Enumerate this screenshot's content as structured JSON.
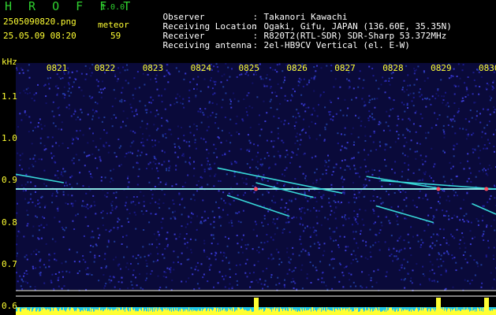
{
  "header": {
    "brand": "H R O F F T",
    "version": "1.0.0",
    "filename": "2505090820.png",
    "datetime": "25.05.09 08:20",
    "meteor_label": "meteor",
    "meteor_count": "59"
  },
  "info": [
    {
      "key": "Observer",
      "sep": ":",
      "value": "Takanori Kawachi"
    },
    {
      "key": "Receiving Location",
      "sep": ":",
      "value": "Ogaki, Gifu, JAPAN (136.60E, 35.35N)"
    },
    {
      "key": "Receiver",
      "sep": ":",
      "value": "R820T2(RTL-SDR) SDR-Sharp 53.372MHz"
    },
    {
      "key": "Receiving antenna",
      "sep": ":",
      "value": "2el-HB9CV Vertical (el. E-W)"
    }
  ],
  "colors": {
    "title_green": "#2fd02f",
    "label_yellow": "#ffff33",
    "info_white": "#ffffff",
    "noise_blue": "#1a1a8c",
    "background": "#000000"
  },
  "chart_data": {
    "type": "heatmap",
    "ylabel": "kHz",
    "x_ticks": [
      "0821",
      "0822",
      "0823",
      "0824",
      "0825",
      "0826",
      "0827",
      "0828",
      "0829",
      "0830"
    ],
    "y_ticks": [
      "1.1",
      "1.0",
      "0.9",
      "0.8",
      "0.7",
      "0.6"
    ],
    "x_range": [
      "0820",
      "0830"
    ],
    "y_range": [
      0.58,
      1.18
    ],
    "carrier_khz": 0.88,
    "meteor_traces": [
      {
        "start_min": 0.0,
        "end_min": 1.0,
        "start_khz": 0.915,
        "end_khz": 0.895
      },
      {
        "start_min": 4.2,
        "end_min": 6.8,
        "start_khz": 0.93,
        "end_khz": 0.87
      },
      {
        "start_min": 4.4,
        "end_min": 5.7,
        "start_khz": 0.865,
        "end_khz": 0.815
      },
      {
        "start_min": 5.0,
        "end_min": 6.2,
        "start_khz": 0.895,
        "end_khz": 0.86
      },
      {
        "start_min": 7.3,
        "end_min": 8.9,
        "start_khz": 0.91,
        "end_khz": 0.88
      },
      {
        "start_min": 7.6,
        "end_min": 10.0,
        "start_khz": 0.9,
        "end_khz": 0.88
      },
      {
        "start_min": 7.5,
        "end_min": 8.7,
        "start_khz": 0.84,
        "end_khz": 0.8
      },
      {
        "start_min": 9.5,
        "end_min": 10.0,
        "start_khz": 0.845,
        "end_khz": 0.82
      }
    ],
    "grid": false
  }
}
